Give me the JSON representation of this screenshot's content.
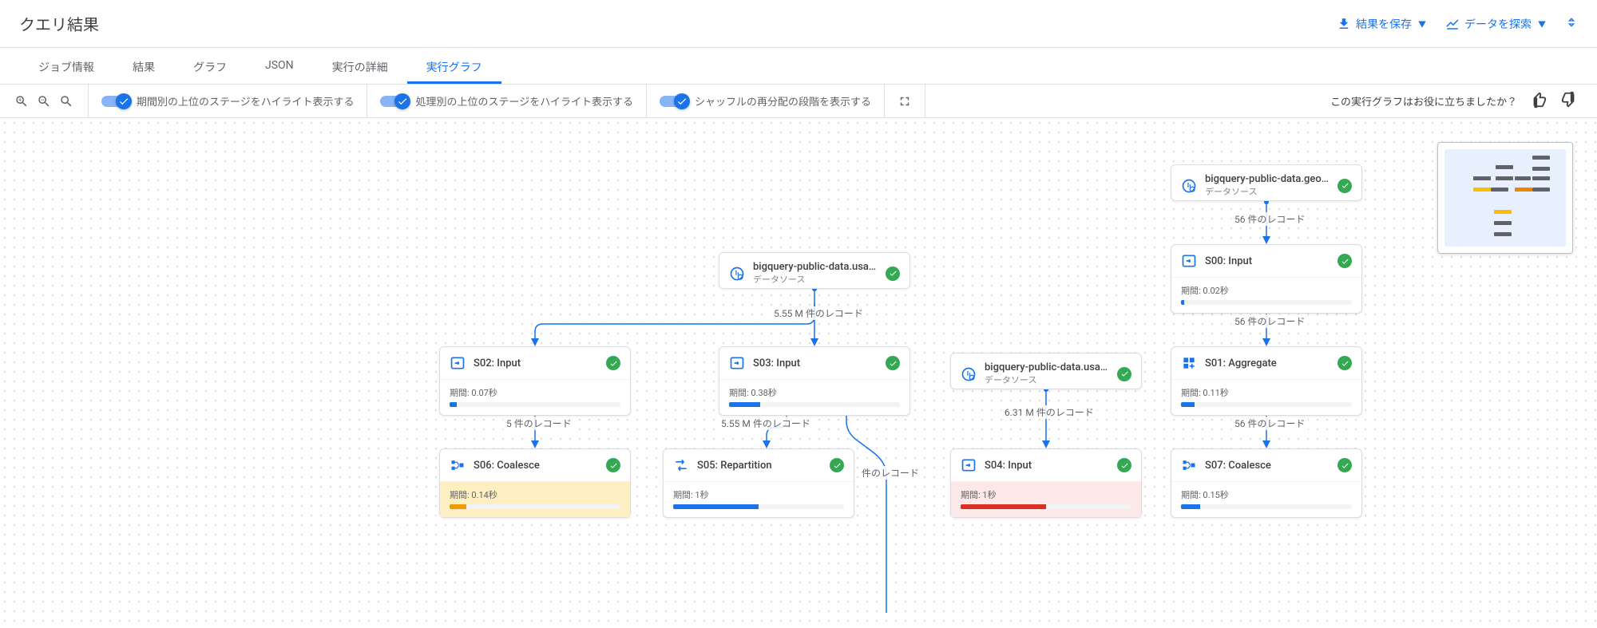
{
  "header": {
    "title": "クエリ結果",
    "save_results": "結果を保存",
    "explore_data": "データを探索"
  },
  "tabs": [
    {
      "id": "job-info",
      "label": "ジョブ情報"
    },
    {
      "id": "results",
      "label": "結果"
    },
    {
      "id": "graph",
      "label": "グラフ"
    },
    {
      "id": "json",
      "label": "JSON"
    },
    {
      "id": "exec-details",
      "label": "実行の詳細"
    },
    {
      "id": "exec-graph",
      "label": "実行グラフ",
      "active": true
    }
  ],
  "toolbar": {
    "toggle_stages_by_time": "期間別の上位のステージをハイライト表示する",
    "toggle_stages_by_proc": "処理別の上位のステージをハイライト表示する",
    "toggle_shuffle": "シャッフルの再分配の段階を表示する",
    "feedback_text": "この実行グラフはお役に立ちましたか？"
  },
  "nodes": {
    "ds_geo": {
      "title": "bigquery-public-data.geo_u",
      "sub": "データソース"
    },
    "ds_usa1": {
      "title": "bigquery-public-data.usa_n",
      "sub": "データソース"
    },
    "ds_usa2": {
      "title": "bigquery-public-data.usa_n",
      "sub": "データソース"
    },
    "s00": {
      "title": "S00: Input",
      "dur": "期間: 0.02秒",
      "fill": 2
    },
    "s01": {
      "title": "S01: Aggregate",
      "dur": "期間: 0.11秒",
      "fill": 8
    },
    "s02": {
      "title": "S02: Input",
      "dur": "期間: 0.07秒",
      "fill": 4
    },
    "s03": {
      "title": "S03: Input",
      "dur": "期間: 0.38秒",
      "fill": 18
    },
    "s04": {
      "title": "S04: Input",
      "dur": "期間: 1秒",
      "fill": 50
    },
    "s05": {
      "title": "S05: Repartition",
      "dur": "期間: 1秒",
      "fill": 50
    },
    "s06": {
      "title": "S06: Coalesce",
      "dur": "期間: 0.14秒",
      "fill": 10
    },
    "s07": {
      "title": "S07: Coalesce",
      "dur": "期間: 0.15秒",
      "fill": 11
    }
  },
  "edges": {
    "e_geo_s00": "56 件のレコード",
    "e_s00_s01": "56 件のレコード",
    "e_s01_s07": "56 件のレコード",
    "e_usa1_s03": "5.55 M 件のレコード",
    "e_s02_s06": "5 件のレコード",
    "e_s03_s05": "5.55 M 件のレコード",
    "e_usa2_s04": "6.31 M 件のレコード",
    "e_partial": "件のレコード"
  }
}
